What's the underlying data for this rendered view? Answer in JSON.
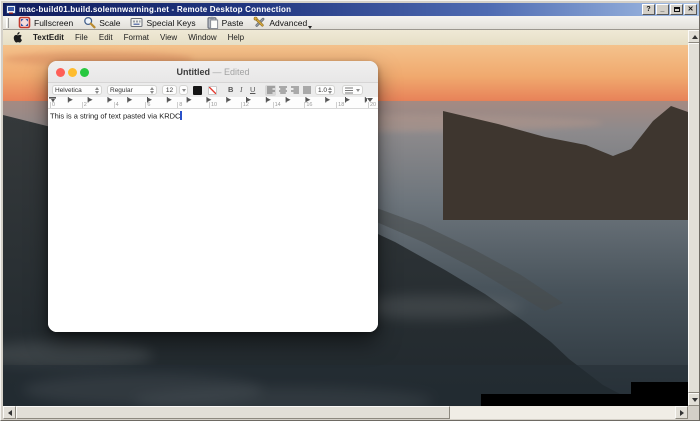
{
  "window": {
    "title": "mac-build01.build.solemnwarning.net - Remote Desktop Connection",
    "controls": {
      "help": "?",
      "minimize": "_",
      "close": "✕"
    }
  },
  "toolbar": {
    "items": [
      "Fullscreen",
      "Scale",
      "Special Keys",
      "Paste",
      "Advanced"
    ]
  },
  "remote": {
    "menubar": {
      "app": "TextEdit",
      "items": [
        "File",
        "Edit",
        "Format",
        "View",
        "Window",
        "Help"
      ]
    },
    "textedit": {
      "title": "Untitled",
      "edited_state": "— Edited",
      "format_bar": {
        "font_family": "Helvetica",
        "font_style": "Regular",
        "font_size": "12",
        "bold": "B",
        "italic": "I",
        "underline": "U",
        "line_spacing": "1.0"
      },
      "ruler_numbers": [
        "0",
        "2",
        "4",
        "6",
        "8",
        "10",
        "12",
        "14",
        "16",
        "18",
        "20"
      ],
      "document_text": "This is a string of text pasted via KRDC"
    }
  },
  "colors": {
    "titlebar_left": "#101d5e",
    "titlebar_right": "#a7c2e7",
    "menubar_bg": "#ebe5d0",
    "traffic_red": "#ff5f57",
    "traffic_yellow": "#febc2e",
    "traffic_green": "#28c840",
    "caret": "#2a52c9",
    "sky_top": "#f4c28c",
    "sunset_horizon": "#d4674a",
    "sea_deep": "#2a343b"
  }
}
